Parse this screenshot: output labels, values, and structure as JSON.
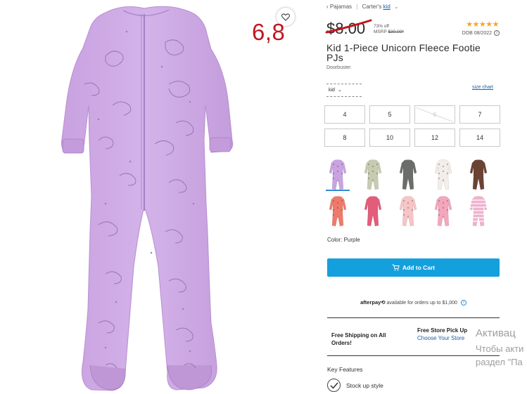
{
  "overlay": {
    "number": "6,8"
  },
  "breadcrumb": {
    "back": "‹ Pajamas",
    "brand": "Carter's",
    "current": "kid"
  },
  "price": {
    "current": "$8.00",
    "discount": "73% off",
    "msrp_label": "MSRP",
    "msrp_value": "$30.00*"
  },
  "rating": {
    "stars": "★★★★★",
    "dob": "DOB 08/2022"
  },
  "product": {
    "title": "Kid 1-Piece Unicorn Fleece Footie PJs",
    "subtitle": "Doorbuster"
  },
  "size_selector": {
    "type": "kid",
    "size_chart": "size chart"
  },
  "sizes": [
    {
      "label": "4",
      "available": true
    },
    {
      "label": "5",
      "available": true
    },
    {
      "label": "6",
      "available": false
    },
    {
      "label": "7",
      "available": true
    },
    {
      "label": "8",
      "available": true
    },
    {
      "label": "10",
      "available": true
    },
    {
      "label": "12",
      "available": true
    },
    {
      "label": "14",
      "available": true
    }
  ],
  "swatches": [
    {
      "color": "#c9a3e2",
      "selected": true,
      "pattern": "unicorn"
    },
    {
      "color": "#c7ccb1",
      "selected": false,
      "pattern": "print"
    },
    {
      "color": "#6b6d6b",
      "selected": false,
      "pattern": "solid"
    },
    {
      "color": "#f4eeea",
      "selected": false,
      "pattern": "floral"
    },
    {
      "color": "#6a4334",
      "selected": false,
      "pattern": "solid"
    },
    {
      "color": "#f07a6a",
      "selected": false,
      "pattern": "print"
    },
    {
      "color": "#e35d7a",
      "selected": false,
      "pattern": "solid"
    },
    {
      "color": "#f7c5c6",
      "selected": false,
      "pattern": "print"
    },
    {
      "color": "#f4a6bd",
      "selected": false,
      "pattern": "print"
    },
    {
      "color": "#f0b2cf",
      "selected": false,
      "pattern": "stripe"
    }
  ],
  "color_label": "Color: Purple",
  "add_to_cart": "Add to Cart",
  "afterpay": {
    "brand": "afterpay⟲",
    "text": "available for orders up to $1,000"
  },
  "shipping": {
    "free_shipping": "Free Shipping on All Orders!",
    "pickup_title": "Free Store Pick Up",
    "pickup_link": "Choose Your Store"
  },
  "key_features": {
    "title": "Key Features",
    "item": "Stock up style"
  },
  "watermark": {
    "line1": "Активац",
    "line2": "Чтобы акти",
    "line3": "раздел \"Па"
  },
  "colors": {
    "accent": "#14a0dc",
    "price_overlay": "#c0171f",
    "star": "#f5a623",
    "link": "#1a5ea8",
    "product": "#c9a3e2"
  }
}
